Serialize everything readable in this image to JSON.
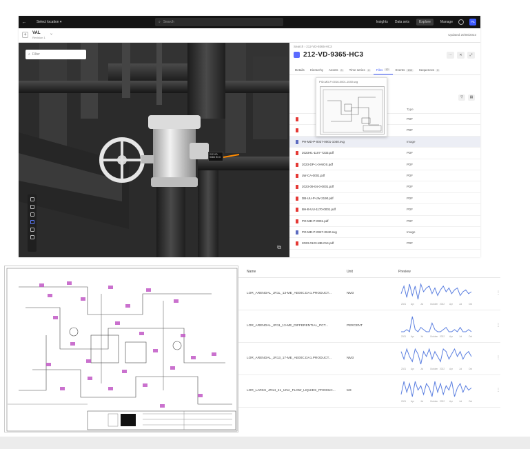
{
  "topbar": {
    "back": "←",
    "project": "Select location ▾",
    "search_placeholder": "Search",
    "nav": [
      "Insights",
      "Data sets",
      "Explore",
      "Manage"
    ],
    "active_nav": "Explore",
    "user": "PA"
  },
  "subbar": {
    "view_name": "VAL",
    "view_sub": "Revision 1",
    "chevron": "⌄",
    "plus": "+",
    "updated": "Updated 20/08/2023"
  },
  "viewer": {
    "search_placeholder": "Filter",
    "tag_lines": [
      "212 VD",
      "9365 HC3"
    ],
    "cube": "⧉"
  },
  "panel": {
    "breadcrumb": "Search › 212-VD-9365-HC3",
    "title": "212-VD-9365-HC3",
    "actions": [
      "⋯",
      "✕",
      "⤢"
    ],
    "tabs": [
      {
        "label": "Details",
        "count": ""
      },
      {
        "label": "Hierarchy",
        "count": ""
      },
      {
        "label": "Assets",
        "count": "0"
      },
      {
        "label": "Time series",
        "count": "4"
      },
      {
        "label": "Files",
        "count": "12"
      },
      {
        "label": "Events",
        "count": "100"
      },
      {
        "label": "Sequences",
        "count": "0"
      }
    ],
    "active_tab": "Files",
    "tools": [
      "▽",
      "▤"
    ],
    "preview_label": "PID-MD-P-0016-0001-1040.svg",
    "table_header": {
      "type": "Type"
    },
    "files": [
      {
        "name": "",
        "type": "PDF",
        "kind": "pdf"
      },
      {
        "name": "",
        "type": "PDF",
        "kind": "pdf"
      },
      {
        "name": "PH-MD-P-0027-0001-1040.svg",
        "type": "Image",
        "kind": "img",
        "selected": true
      },
      {
        "name": "2023H1-1107-7233.pdf",
        "type": "PDF",
        "kind": "pdf"
      },
      {
        "name": "2023-DP-1-0-MOS.pdf",
        "type": "PDF",
        "kind": "pdf"
      },
      {
        "name": "LW-CA-0001.pdf",
        "type": "PDF",
        "kind": "pdf"
      },
      {
        "name": "2023-09-04-0-0001.pdf",
        "type": "PDF",
        "kind": "pdf"
      },
      {
        "name": "DB-UU-P-LW-2190.pdf",
        "type": "PDF",
        "kind": "pdf"
      },
      {
        "name": "BH-B-UU-1170-0001.pdf",
        "type": "PDF",
        "kind": "pdf"
      },
      {
        "name": "PO-MD-P-0001.pdf",
        "type": "PDF",
        "kind": "pdf"
      },
      {
        "name": "PO-MD-P-0027-0040.svg",
        "type": "Image",
        "kind": "img"
      },
      {
        "name": "2023-0123-MB-014.pdf",
        "type": "PDF",
        "kind": "pdf"
      }
    ]
  },
  "timeseries": {
    "headers": {
      "name": "Name",
      "unit": "Unit",
      "preview": "Preview"
    },
    "rows": [
      {
        "name": "LOR_ARENDAL_JR1L_13-ME_AE00C.DA1.PRODUCT...",
        "unit": "NM3",
        "kebab": "⋮",
        "spark": [
          5,
          9,
          3,
          10,
          4,
          9,
          2,
          10,
          6,
          8,
          9,
          5,
          8,
          4,
          7,
          9,
          6,
          8,
          5,
          7,
          8,
          4,
          6,
          7,
          5,
          6
        ]
      },
      {
        "name": "LOR_ARENDAL_JR11_13-ME_DIFFERENTIAL_PCT...",
        "unit": "PERCENT",
        "kebab": "⋮",
        "spark": [
          2,
          2,
          3,
          2,
          9,
          3,
          2,
          4,
          3,
          2,
          2,
          6,
          3,
          2,
          2,
          3,
          4,
          2,
          2,
          3,
          2,
          4,
          2,
          2,
          3,
          2
        ],
        "axis": [
          "2021",
          "Apr",
          "Jul",
          "October",
          "2022",
          "Apr",
          "Jul",
          "Oct"
        ]
      },
      {
        "name": "LOR_ARENDAL_JR13_17-ME_AE00C.DA1.PRODUCT...",
        "unit": "NM3",
        "kebab": "⋮",
        "spark": [
          8,
          5,
          9,
          6,
          4,
          9,
          7,
          3,
          8,
          6,
          9,
          5,
          8,
          6,
          4,
          9,
          8,
          5,
          7,
          9,
          6,
          8,
          5,
          7,
          8,
          6
        ]
      },
      {
        "name": "LOR_LARKS_JR14_21_UNA_FLOW_LIQUIDS_PRODUC...",
        "unit": "M3",
        "kebab": "⋮",
        "spark": [
          3,
          9,
          4,
          8,
          2,
          9,
          5,
          7,
          3,
          8,
          6,
          2,
          9,
          4,
          8,
          3,
          7,
          5,
          9,
          2,
          6,
          8,
          4,
          7,
          5,
          6
        ]
      }
    ],
    "axis": [
      "2021",
      "Apr",
      "Jul",
      "October",
      "2022",
      "Apr",
      "Jul",
      "Oct"
    ]
  },
  "colors": {
    "accent": "#3d5afe",
    "spark": "#5b7fe0",
    "topbar": "#141414",
    "viewer_bg": "#2a2a2a",
    "pdf_icon": "#e53935",
    "img_icon": "#5c6bc0",
    "tag_highlight": "#c158c6"
  }
}
